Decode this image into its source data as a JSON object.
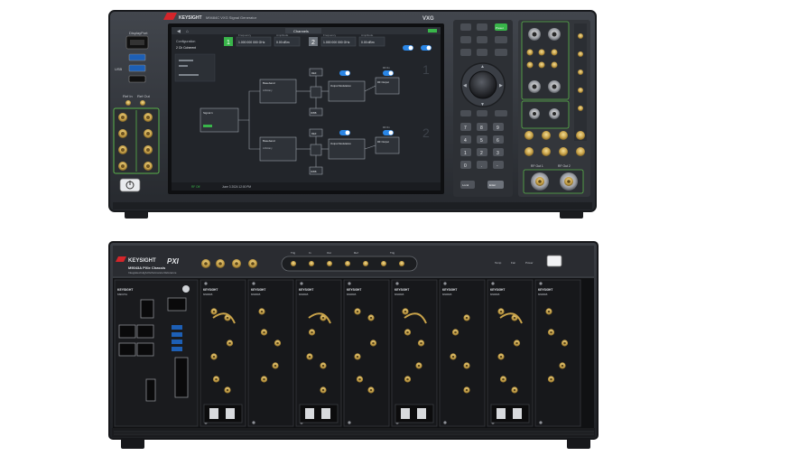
{
  "top_instrument": {
    "brand": "KEYSIGHT",
    "model_title": "M9484C VXG Signal Generator",
    "series": "VXG",
    "left_labels": {
      "displayport": "DisplayPort",
      "usb": "USB",
      "ref_in": "Ref In",
      "ref_out": "Ref Out"
    },
    "screen": {
      "tab": "Channels",
      "fields": [
        {
          "label": "Frequency",
          "value": "1.000 000 000 GHz"
        },
        {
          "label": "Amplitude",
          "value": "0.00 dBm"
        },
        {
          "label": "Frequency",
          "value": "1.000 000 000 GHz"
        },
        {
          "label": "Amplitude",
          "value": "0.00 dBm"
        }
      ],
      "configuration_label": "Configuration",
      "ch_label": "2 Ch Coherent",
      "channel_numbers": [
        "1",
        "2"
      ],
      "blocks": {
        "signal1": "Signal 1",
        "arbitrary": [
          "Arbitrary",
          "Arbitrary"
        ],
        "baseband": [
          "Baseband",
          "Baseband"
        ],
        "ref": [
          "REF",
          "REF"
        ],
        "ifbb": [
          "IF/BB",
          "IF/BB"
        ],
        "output_modulation": [
          "Output Modulation",
          "Output Modulation"
        ],
        "rf_output": [
          "RF Output",
          "RF Output"
        ],
        "rf_on": [
          "RF On",
          "RF On"
        ]
      },
      "status_bar": {
        "left": "RF Off",
        "time": "June 3 2024 12:00 PM"
      }
    },
    "keypad": {
      "preset": "Preset",
      "keys": [
        "7",
        "8",
        "9",
        "4",
        "5",
        "6",
        "1",
        "2",
        "3",
        "0",
        ".",
        "-"
      ],
      "enter": "Enter",
      "local": "Local"
    },
    "right_labels": {
      "rf_out_1": "RF Out 1",
      "rf_out_2": "RF Out 2"
    }
  },
  "bottom_chassis": {
    "brand": "KEYSIGHT",
    "pxi_logo": "PXI",
    "model": "M9043A PXIe Chassis",
    "subtitle": "Integrated High-Performance Reference",
    "module_brand": "KEYSIGHT",
    "module_models": [
      "M9037A",
      "M9061B",
      "M9061B",
      "M9061B",
      "M9061B",
      "M9061B",
      "M9061B",
      "M9061B"
    ],
    "trigger_labels": [
      "Trig",
      "In",
      "Out",
      "Ref",
      "Trig"
    ],
    "power_labels": [
      "Temp",
      "Fan",
      "Power"
    ]
  },
  "colors": {
    "panel_dark": "#2b2e33",
    "panel_mid": "#3a3d43",
    "screen_bg": "#22252a",
    "accent_blue": "#2a86e6",
    "accent_green": "#39b54a",
    "sma_gold": "#c9a34a",
    "brand_red": "#d4252a"
  }
}
